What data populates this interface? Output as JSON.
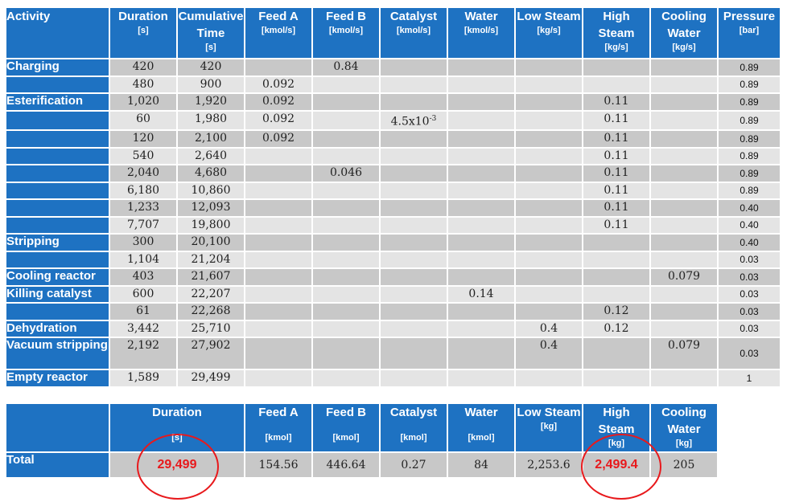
{
  "headers": [
    {
      "label": "Activity",
      "unit": ""
    },
    {
      "label": "Duration",
      "unit": "[s]"
    },
    {
      "label": "Cumulative Time",
      "unit": "[s]"
    },
    {
      "label": "Feed A",
      "unit": "[kmol/s]"
    },
    {
      "label": "Feed B",
      "unit": "[kmol/s]"
    },
    {
      "label": "Catalyst",
      "unit": "[kmol/s]"
    },
    {
      "label": "Water",
      "unit": "[kmol/s]"
    },
    {
      "label": "Low Steam",
      "unit": "[kg/s]"
    },
    {
      "label": "High Steam",
      "unit": "[kg/s]"
    },
    {
      "label": "Cooling Water",
      "unit": "[kg/s]"
    },
    {
      "label": "Pressure",
      "unit": "[bar]"
    }
  ],
  "rows": [
    {
      "activity": "Charging",
      "duration": "420",
      "cumulative": "420",
      "feed_a": "",
      "feed_b": "0.84",
      "catalyst": "",
      "water": "",
      "low_steam": "",
      "high_steam": "",
      "cooling": "",
      "pressure": "0.89"
    },
    {
      "activity": "",
      "duration": "480",
      "cumulative": "900",
      "feed_a": "0.092",
      "feed_b": "",
      "catalyst": "",
      "water": "",
      "low_steam": "",
      "high_steam": "",
      "cooling": "",
      "pressure": "0.89"
    },
    {
      "activity": "Esterification",
      "duration": "1,020",
      "cumulative": "1,920",
      "feed_a": "0.092",
      "feed_b": "",
      "catalyst": "",
      "water": "",
      "low_steam": "",
      "high_steam": "0.11",
      "cooling": "",
      "pressure": "0.89"
    },
    {
      "activity": "",
      "duration": "60",
      "cumulative": "1,980",
      "feed_a": "0.092",
      "feed_b": "",
      "catalyst": "4.5x10-3",
      "water": "",
      "low_steam": "",
      "high_steam": "0.11",
      "cooling": "",
      "pressure": "0.89"
    },
    {
      "activity": "",
      "duration": "120",
      "cumulative": "2,100",
      "feed_a": "0.092",
      "feed_b": "",
      "catalyst": "",
      "water": "",
      "low_steam": "",
      "high_steam": "0.11",
      "cooling": "",
      "pressure": "0.89"
    },
    {
      "activity": "",
      "duration": "540",
      "cumulative": "2,640",
      "feed_a": "",
      "feed_b": "",
      "catalyst": "",
      "water": "",
      "low_steam": "",
      "high_steam": "0.11",
      "cooling": "",
      "pressure": "0.89"
    },
    {
      "activity": "",
      "duration": "2,040",
      "cumulative": "4,680",
      "feed_a": "",
      "feed_b": "0.046",
      "catalyst": "",
      "water": "",
      "low_steam": "",
      "high_steam": "0.11",
      "cooling": "",
      "pressure": "0.89"
    },
    {
      "activity": "",
      "duration": "6,180",
      "cumulative": "10,860",
      "feed_a": "",
      "feed_b": "",
      "catalyst": "",
      "water": "",
      "low_steam": "",
      "high_steam": "0.11",
      "cooling": "",
      "pressure": "0.89"
    },
    {
      "activity": "",
      "duration": "1,233",
      "cumulative": "12,093",
      "feed_a": "",
      "feed_b": "",
      "catalyst": "",
      "water": "",
      "low_steam": "",
      "high_steam": "0.11",
      "cooling": "",
      "pressure": "0.40"
    },
    {
      "activity": "",
      "duration": "7,707",
      "cumulative": "19,800",
      "feed_a": "",
      "feed_b": "",
      "catalyst": "",
      "water": "",
      "low_steam": "",
      "high_steam": "0.11",
      "cooling": "",
      "pressure": "0.40"
    },
    {
      "activity": "Stripping",
      "duration": "300",
      "cumulative": "20,100",
      "feed_a": "",
      "feed_b": "",
      "catalyst": "",
      "water": "",
      "low_steam": "",
      "high_steam": "",
      "cooling": "",
      "pressure": "0.40"
    },
    {
      "activity": "",
      "duration": "1,104",
      "cumulative": "21,204",
      "feed_a": "",
      "feed_b": "",
      "catalyst": "",
      "water": "",
      "low_steam": "",
      "high_steam": "",
      "cooling": "",
      "pressure": "0.03"
    },
    {
      "activity": "Cooling reactor",
      "duration": "403",
      "cumulative": "21,607",
      "feed_a": "",
      "feed_b": "",
      "catalyst": "",
      "water": "",
      "low_steam": "",
      "high_steam": "",
      "cooling": "0.079",
      "pressure": "0.03"
    },
    {
      "activity": "Killing catalyst",
      "duration": "600",
      "cumulative": "22,207",
      "feed_a": "",
      "feed_b": "",
      "catalyst": "",
      "water": "0.14",
      "low_steam": "",
      "high_steam": "",
      "cooling": "",
      "pressure": "0.03"
    },
    {
      "activity": "",
      "duration": "61",
      "cumulative": "22,268",
      "feed_a": "",
      "feed_b": "",
      "catalyst": "",
      "water": "",
      "low_steam": "",
      "high_steam": "0.12",
      "cooling": "",
      "pressure": "0.03"
    },
    {
      "activity": "Dehydration",
      "duration": "3,442",
      "cumulative": "25,710",
      "feed_a": "",
      "feed_b": "",
      "catalyst": "",
      "water": "",
      "low_steam": "0.4",
      "high_steam": "0.12",
      "cooling": "",
      "pressure": "0.03"
    },
    {
      "activity": "Vacuum stripping",
      "duration": "2,192",
      "cumulative": "27,902",
      "feed_a": "",
      "feed_b": "",
      "catalyst": "",
      "water": "",
      "low_steam": "0.4",
      "high_steam": "",
      "cooling": "0.079",
      "pressure": "0.03"
    },
    {
      "activity": "Empty reactor",
      "duration": "1,589",
      "cumulative": "29,499",
      "feed_a": "",
      "feed_b": "",
      "catalyst": "",
      "water": "",
      "low_steam": "",
      "high_steam": "",
      "cooling": "",
      "pressure": "1"
    }
  ],
  "totals": {
    "headers": [
      {
        "label": "",
        "unit": ""
      },
      {
        "label": "Duration",
        "unit": "[s]"
      },
      {
        "label": "Feed A",
        "unit": "[kmol]"
      },
      {
        "label": "Feed B",
        "unit": "[kmol]"
      },
      {
        "label": "Catalyst",
        "unit": "[kmol]"
      },
      {
        "label": "Water",
        "unit": "[kmol]"
      },
      {
        "label": "Low Steam",
        "unit": "[kg]"
      },
      {
        "label": "High Steam",
        "unit": "[kg]"
      },
      {
        "label": "Cooling Water",
        "unit": "[kg]"
      }
    ],
    "label": "Total",
    "values": [
      "29,499",
      "154.56",
      "446.64",
      "0.27",
      "84",
      "2,253.6",
      "2,499.4",
      "205"
    ],
    "highlight_color": "#e8191c"
  },
  "colors": {
    "header_bg": "#1e72c2",
    "row_dark": "#c8c8c8",
    "row_light": "#e4e4e4"
  }
}
